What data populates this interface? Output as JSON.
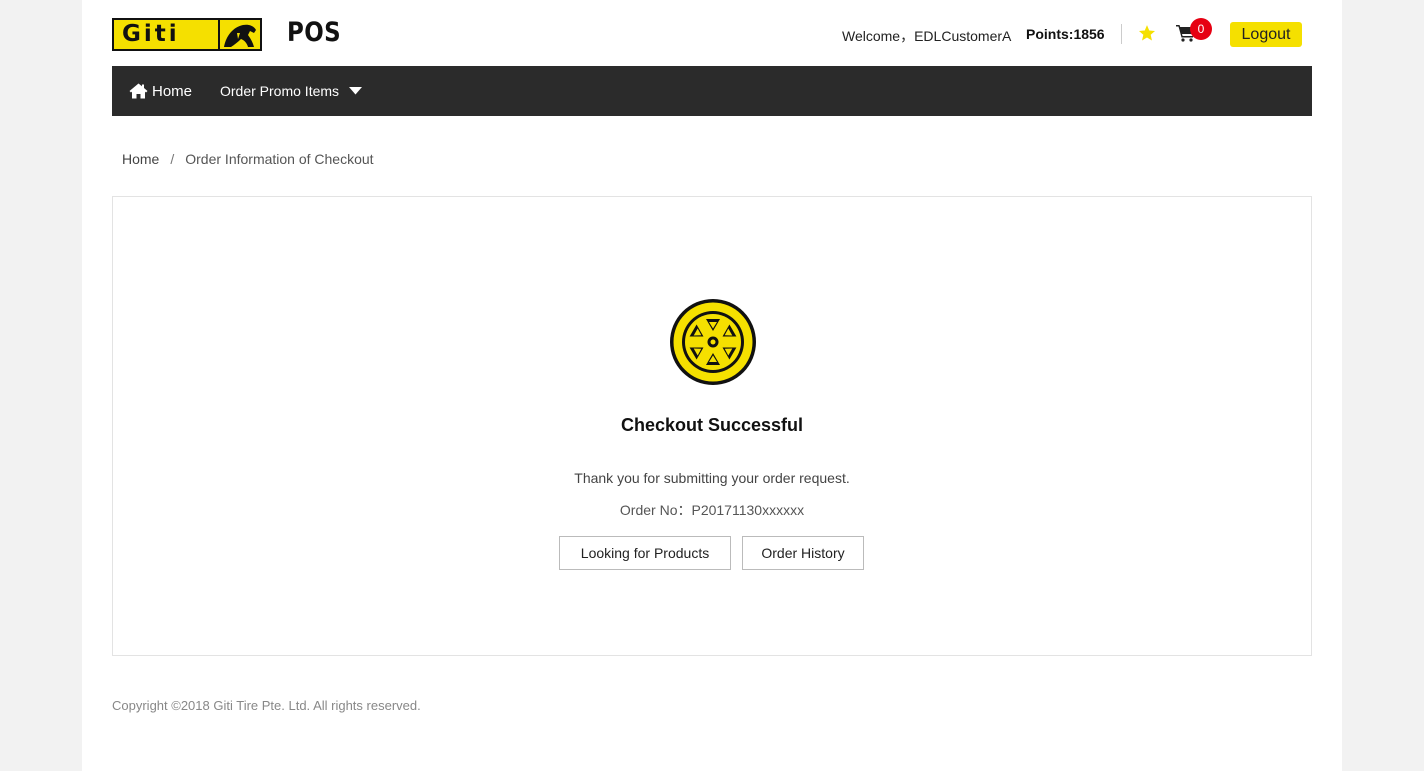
{
  "header": {
    "logo_text": "Giti",
    "brand": "POS",
    "welcome_prefix": "Welcome，",
    "username": "EDLCustomerA",
    "points_label": "Points:",
    "points_value": "1856",
    "cart_count": "0",
    "logout_label": "Logout",
    "icons": [
      "star-icon",
      "cart-icon"
    ],
    "accent_color": "#f5e000",
    "badge_color": "#e60012"
  },
  "nav": {
    "home_label": "Home",
    "order_promo_label": "Order Promo Items",
    "icons": [
      "home-icon",
      "caret-down-icon"
    ],
    "background": "#2b2b2b"
  },
  "breadcrumb": {
    "items": [
      "Home",
      "Order Information of Checkout"
    ],
    "separator": "/"
  },
  "main": {
    "icon": "tire-wheel-icon",
    "title": "Checkout Successful",
    "message": "Thank you for submitting your order request.",
    "order_no_label": "Order No：",
    "order_no_value": "P20171130xxxxxx",
    "buttons": {
      "products_label": "Looking for Products",
      "history_label": "Order History"
    }
  },
  "footer": {
    "copyright": "Copyright ©2018 Giti Tire Pte. Ltd. All rights reserved."
  }
}
